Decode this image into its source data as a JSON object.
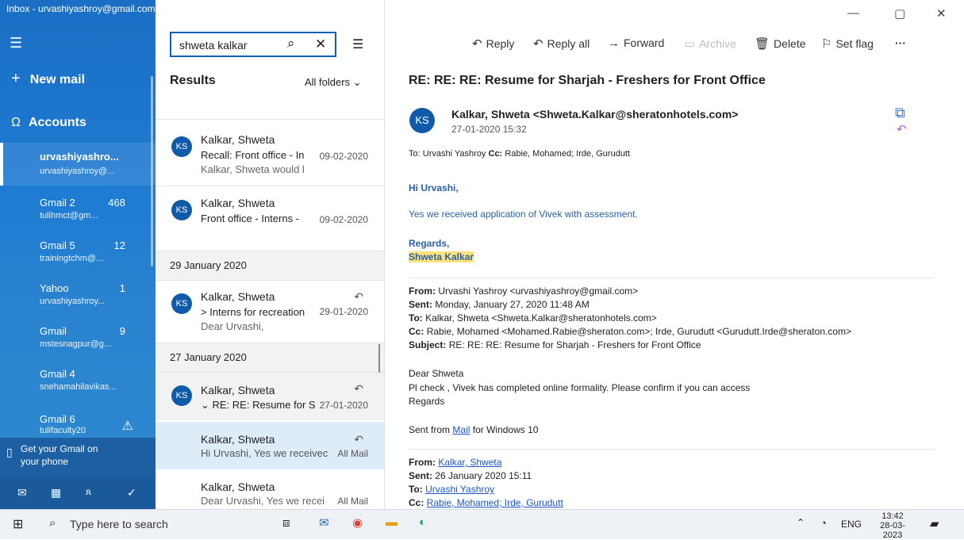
{
  "window": {
    "title": "Inbox - urvashiyashroy@gmail.com",
    "minimize_glyph": "—",
    "maximize_glyph": "▢",
    "close_glyph": "✕"
  },
  "nav": {
    "new_mail": "New mail",
    "accounts_label": "Accounts",
    "accounts": [
      {
        "name": "urvashiyashro...",
        "email": "urvashiyashroy@...",
        "count": ""
      },
      {
        "name": "Gmail 2",
        "email": "tulihmct@gm...",
        "count": "468"
      },
      {
        "name": "Gmail 5",
        "email": "trainingtchm@...",
        "count": "12"
      },
      {
        "name": "Yahoo",
        "email": "urvashiyashroy...",
        "count": "1"
      },
      {
        "name": "Gmail",
        "email": "mstesnagpur@g...",
        "count": "9"
      },
      {
        "name": "Gmail 4",
        "email": "snehamahilavikas...",
        "count": ""
      },
      {
        "name": "Gmail 6",
        "email": "tulifaculty20",
        "count": ""
      }
    ],
    "phone_promo": "Get your Gmail on your phone"
  },
  "search": {
    "value": "shweta kalkar"
  },
  "list": {
    "results_label": "Results",
    "folder_filter": "All folders",
    "items": [
      {
        "avatar": "KS",
        "from": "Kalkar, Shweta",
        "subject": "Recall: Front office - In",
        "date": "09-02-2020",
        "preview": "Kalkar, Shweta would l"
      },
      {
        "avatar": "KS",
        "from": "Kalkar, Shweta",
        "subject": "Front office - Interns -",
        "date": "09-02-2020",
        "preview": ""
      },
      {
        "avatar": "KS",
        "from": "Kalkar, Shweta",
        "subject": "> Interns for recreation",
        "date": "29-01-2020",
        "preview": "Dear Urvashi,"
      },
      {
        "avatar": "KS",
        "from": "Kalkar, Shweta",
        "subject": "RE: RE: Resume for S",
        "date": "27-01-2020",
        "preview": ""
      },
      {
        "avatar": "",
        "from": "Kalkar, Shweta",
        "subject": "",
        "date": "All Mail",
        "preview": "Hi Urvashi, Yes we receivec"
      },
      {
        "avatar": "",
        "from": "Kalkar, Shweta",
        "subject": "",
        "date": "All Mail",
        "preview": "Dear Urvashi, Yes we recei"
      }
    ],
    "groups": [
      "29 January 2020",
      "27 January 2020"
    ]
  },
  "toolbar": {
    "reply": "Reply",
    "reply_all": "Reply all",
    "forward": "Forward",
    "archive": "Archive",
    "delete": "Delete",
    "set_flag": "Set flag",
    "more": "···"
  },
  "message": {
    "subject": "RE: RE: RE: Resume for Sharjah - Freshers for Front Office",
    "avatar": "KS",
    "sender": "Kalkar, Shweta <Shweta.Kalkar@sheratonhotels.com>",
    "date": "27-01-2020 15:32",
    "to_label": "To:",
    "to": "Urvashi Yashroy",
    "cc_label": "Cc:",
    "cc": "Rabie, Mohamed; Irde, Gurudutt",
    "greeting": "Hi Urvashi,",
    "line1": "Yes we received application of Vivek with assessment.",
    "regards": "Regards,",
    "signature": "Shweta Kalkar",
    "quoted1": {
      "from_label": "From:",
      "from": "Urvashi Yashroy <urvashiyashroy@gmail.com>",
      "sent_label": "Sent:",
      "sent": "Monday, January 27, 2020 11:48 AM",
      "to_label": "To:",
      "to": "Kalkar, Shweta <Shweta.Kalkar@sheratonhotels.com>",
      "cc_label": "Cc:",
      "cc": "Rabie, Mohamed <Mohamed.Rabie@sheraton.com>; Irde, Gurudutt <Gurudutt.Irde@sheraton.com>",
      "subject_label": "Subject:",
      "subject": "RE: RE: RE: Resume for Sharjah - Freshers for Front Office",
      "body1": "Dear Shweta",
      "body2": "Pl check , Vivek has completed online formality. Please confirm if you can access",
      "body3": "Regards",
      "sent_from_pre": "Sent from",
      "sent_from_link": "Mail",
      "sent_from_post": "for Windows 10"
    },
    "quoted2": {
      "from_label": "From:",
      "from": "Kalkar, Shweta",
      "sent_label": "Sent:",
      "sent": "26 January 2020 15:11",
      "to_label": "To:",
      "to": "Urvashi Yashroy",
      "cc_label": "Cc:",
      "cc": "Rabie, Mohamed; Irde, Gurudutt"
    }
  },
  "taskbar": {
    "search_placeholder": "Type here to search",
    "lang": "ENG",
    "time": "13:42",
    "date": "28-03-2023"
  },
  "colors": {
    "accent": "#0f5ba9",
    "highlight": "#ffe27a",
    "link": "#1a56c8"
  }
}
